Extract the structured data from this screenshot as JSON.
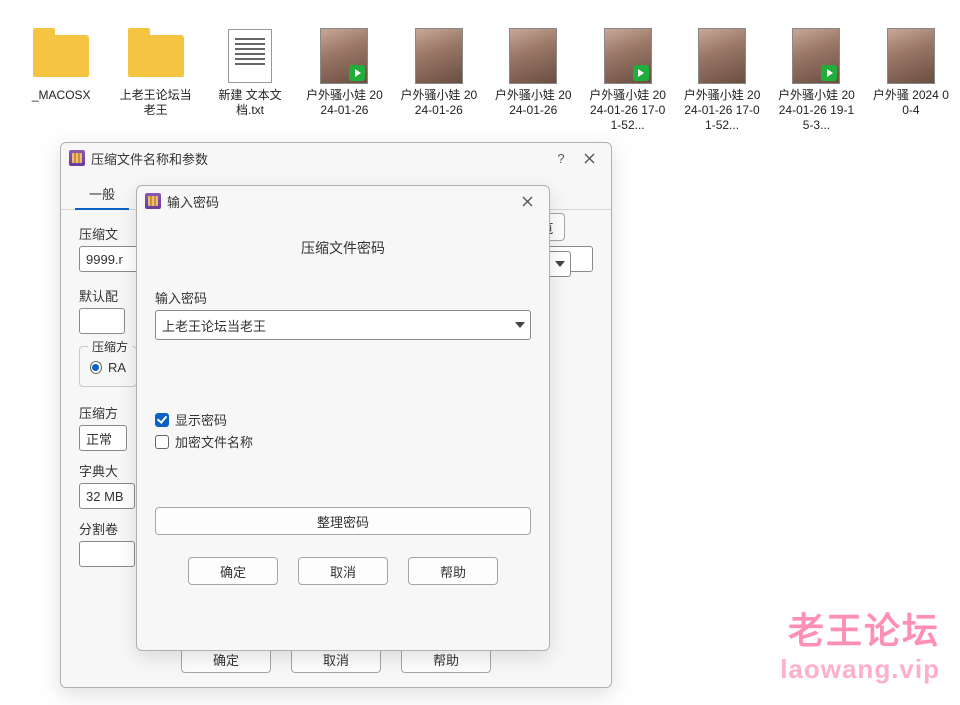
{
  "explorer": {
    "items": [
      {
        "name": "_MACOSX",
        "kind": "folder"
      },
      {
        "name": "上老王论坛当老王",
        "kind": "folder"
      },
      {
        "name": "新建 文本文档.txt",
        "kind": "txt"
      },
      {
        "name": "户外骚小娃 2024-01-26",
        "kind": "video"
      },
      {
        "name": "户外骚小娃 2024-01-26",
        "kind": "image"
      },
      {
        "name": "户外骚小娃 2024-01-26",
        "kind": "image"
      },
      {
        "name": "户外骚小娃 2024-01-26 17-01-52...",
        "kind": "video"
      },
      {
        "name": "户外骚小娃 2024-01-26 17-01-52...",
        "kind": "image"
      },
      {
        "name": "户外骚小娃 2024-01-26 19-15-3...",
        "kind": "video"
      },
      {
        "name": "户外骚 2024 00-4",
        "kind": "image"
      }
    ]
  },
  "archive_dialog": {
    "title": "压缩文件名称和参数",
    "help_glyph": "?",
    "tab_general": "一般",
    "label_archive_name": "压缩文",
    "archive_name_value": "9999.r",
    "browse_partial": "览",
    "label_default_profile": "默认配",
    "group_format": "压缩方",
    "radio_rar": "RA",
    "label_method": "压缩方",
    "method_value": "正常",
    "label_dict": "字典大",
    "dict_value": "32 MB",
    "label_split": "分割卷",
    "btn_ok": "确定",
    "btn_cancel": "取消",
    "btn_help": "帮助"
  },
  "password_dialog": {
    "title": "输入密码",
    "heading": "压缩文件密码",
    "label_enter": "输入密码",
    "password_value": "上老王论坛当老王",
    "check_show": "显示密码",
    "check_encrypt_names": "加密文件名称",
    "btn_organize": "整理密码",
    "btn_ok": "确定",
    "btn_cancel": "取消",
    "btn_help": "帮助"
  },
  "watermark": {
    "line1": "老王论坛",
    "line2": "laowang.vip"
  }
}
